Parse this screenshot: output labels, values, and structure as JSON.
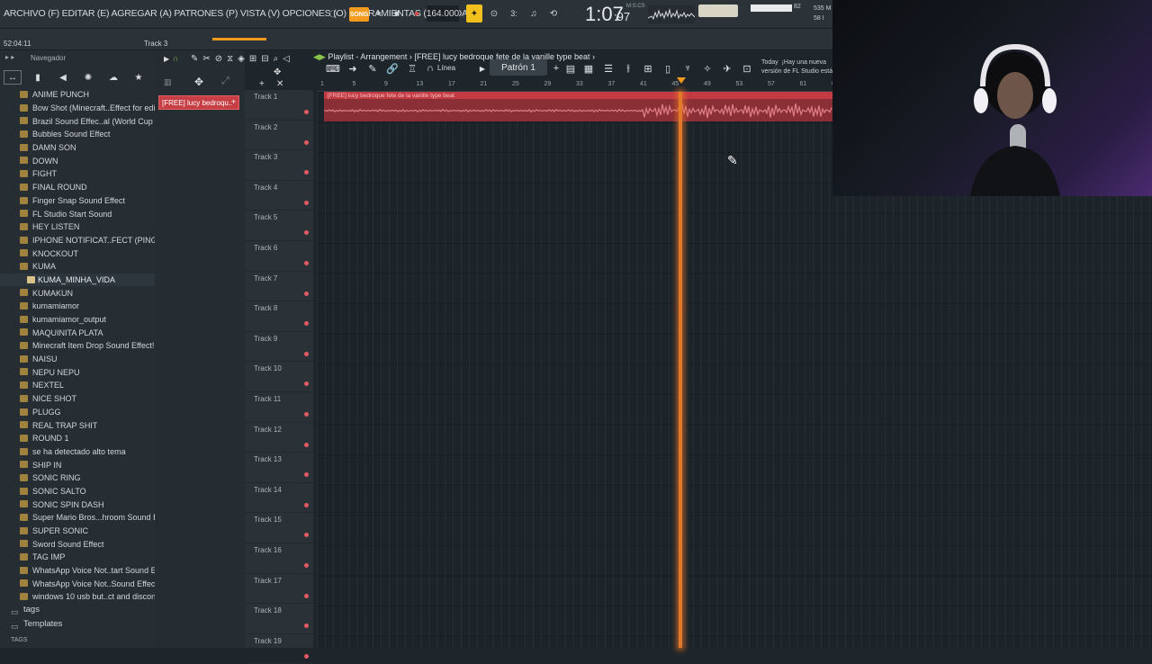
{
  "menu": {
    "text": "ARCHIVO (F) EDITAR (E) AGREGAR (A) PATRONES (P) VISTA (V) OPCIONES (O) HERRAMIENTAS (T) AYUDA"
  },
  "transport": {
    "song": "SONG",
    "tempo": "164.000",
    "time": "1:07",
    "time_frac": ":97",
    "time_unit": "M:S:CS",
    "cpu": "82",
    "mem1": "535 M",
    "mem2": "58 I"
  },
  "toolbar": {
    "line_mode": "Línea",
    "pattern": "Patrón 1",
    "notice_date": "Today",
    "notice_line1": "¡Hay una nueva",
    "notice_line2": "versión de FL Studio está"
  },
  "status": {
    "clock": "52:04:11",
    "track_hint": "Track 3"
  },
  "browser": {
    "title": "Navegador",
    "items": [
      "ANIME PUNCH",
      "Bow Shot (Minecraft..Effect for editing",
      "Brazil Sound Effec..al (World Cup 2002)",
      "Bubbles Sound Effect",
      "DAMN SON",
      "DOWN",
      "FIGHT",
      "FINAL ROUND",
      "Finger Snap Sound Effect",
      "FL Studio Start Sound",
      "HEY LISTEN",
      "IPHONE NOTIFICAT..FECT (PINGDDING)",
      "KNOCKOUT",
      "KUMA",
      "KUMA_MINHA_VIDA",
      "KUMAKUN",
      "kumamiamor",
      "kumamiamor_output",
      "MAQUINITA PLATA",
      "Minecraft Item Drop Sound Effect!",
      "NAISU",
      "NEPU NEPU",
      "NEXTEL",
      "NICE SHOT",
      "PLUGG",
      "REAL TRAP SHIT",
      "ROUND 1",
      "se ha detectado alto tema",
      "SHIP IN",
      "SONIC RING",
      "SONIC SALTO",
      "SONIC SPIN DASH",
      "Super Mario Bros...hroom Sound Effect",
      "SUPER SONIC",
      "Sword Sound Effect",
      "TAG IMP",
      "WhatsApp Voice Not..tart  Sound Effect",
      "WhatsApp Voice Not..Sound Effects HD",
      "windows 10 usb but..ct and disconnect"
    ],
    "folders": [
      "tags",
      "Templates"
    ],
    "tags_label": "TAGS"
  },
  "picker": {
    "pattern_name": "[FREE] lucy bedroqu.."
  },
  "playlist": {
    "title": "Playlist - Arrangement",
    "breadcrumb": "[FREE] lucy bedroque fete de la vanille type beat",
    "clip_label": "[FREE] lucy bedroque fete de la vanille type beat",
    "ruler": [
      "1",
      "5",
      "9",
      "13",
      "17",
      "21",
      "25",
      "29",
      "33",
      "37",
      "41",
      "45",
      "49",
      "53",
      "57",
      "61",
      "6"
    ],
    "tracks": [
      "Track 1",
      "Track 2",
      "Track 3",
      "Track 4",
      "Track 5",
      "Track 6",
      "Track 7",
      "Track 8",
      "Track 9",
      "Track 10",
      "Track 11",
      "Track 12",
      "Track 13",
      "Track 14",
      "Track 15",
      "Track 16",
      "Track 17",
      "Track 18",
      "Track 19"
    ]
  },
  "colors": {
    "accent": "#f29b1c",
    "clip": "#c23a42",
    "playhead": "#e07a2a"
  }
}
